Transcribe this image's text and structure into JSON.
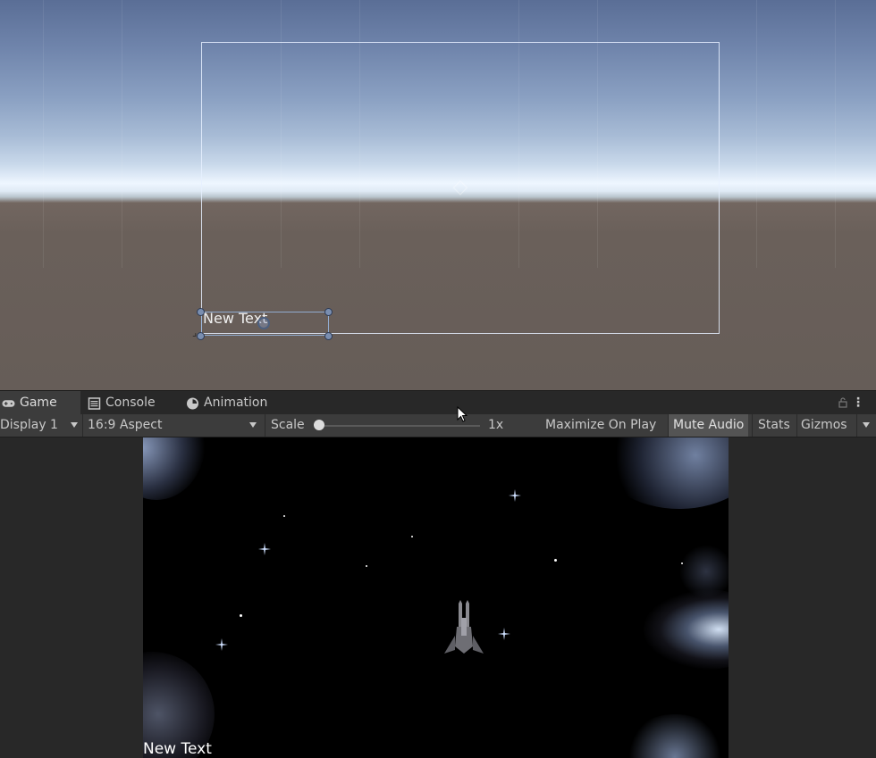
{
  "scene": {
    "canvas_text": "New Text"
  },
  "tabs": [
    {
      "label": "Game",
      "icon": "gamepad-icon",
      "active": true
    },
    {
      "label": "Console",
      "icon": "console-icon",
      "active": false
    },
    {
      "label": "Animation",
      "icon": "clock-icon",
      "active": false
    }
  ],
  "toolbar": {
    "display": "Display 1",
    "aspect": "16:9 Aspect",
    "scale_label": "Scale",
    "scale_value": "1x",
    "scale_level": 0,
    "maximize_on_play": "Maximize On Play",
    "mute_audio": "Mute Audio",
    "mute_audio_active": true,
    "stats": "Stats",
    "gizmos": "Gizmos"
  },
  "game": {
    "ui_text": "New Text"
  }
}
